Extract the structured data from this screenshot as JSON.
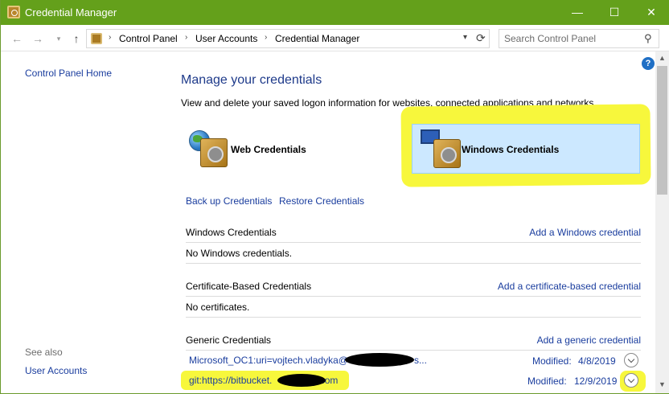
{
  "window": {
    "title": "Credential Manager"
  },
  "window_controls": {
    "minimize": "—",
    "maximize": "☐",
    "close": "✕"
  },
  "address": {
    "crumbs": [
      "Control Panel",
      "User Accounts",
      "Credential Manager"
    ],
    "search_placeholder": "Search Control Panel"
  },
  "sidebar": {
    "home": "Control Panel Home",
    "see_also": "See also",
    "user_accounts": "User Accounts"
  },
  "main": {
    "heading": "Manage your credentials",
    "subtext": "View and delete your saved logon information for websites, connected applications and networks.",
    "tiles": {
      "web": "Web Credentials",
      "windows": "Windows Credentials"
    },
    "backup": "Back up Credentials",
    "restore": "Restore Credentials",
    "sections": {
      "windows": {
        "title": "Windows Credentials",
        "add": "Add a Windows credential",
        "empty": "No Windows credentials."
      },
      "certificate": {
        "title": "Certificate-Based Credentials",
        "add": "Add a certificate-based credential",
        "empty": "No certificates."
      },
      "generic": {
        "title": "Generic Credentials",
        "add": "Add a generic credential"
      }
    },
    "generic_items": [
      {
        "name_prefix": "Microsoft_OC1:uri=vojtech.vladyka@",
        "name_suffix": "s...",
        "modified_label": "Modified:",
        "modified_date": "4/8/2019"
      },
      {
        "name_prefix": "git:https://bitbucket.",
        "name_suffix": ".com",
        "modified_label": "Modified:",
        "modified_date": "12/9/2019"
      }
    ]
  },
  "colors": {
    "titlebar": "#64a01b",
    "link": "#1a3d9e",
    "highlight": "#f7f73c",
    "selected_tile": "#cce8ff"
  }
}
